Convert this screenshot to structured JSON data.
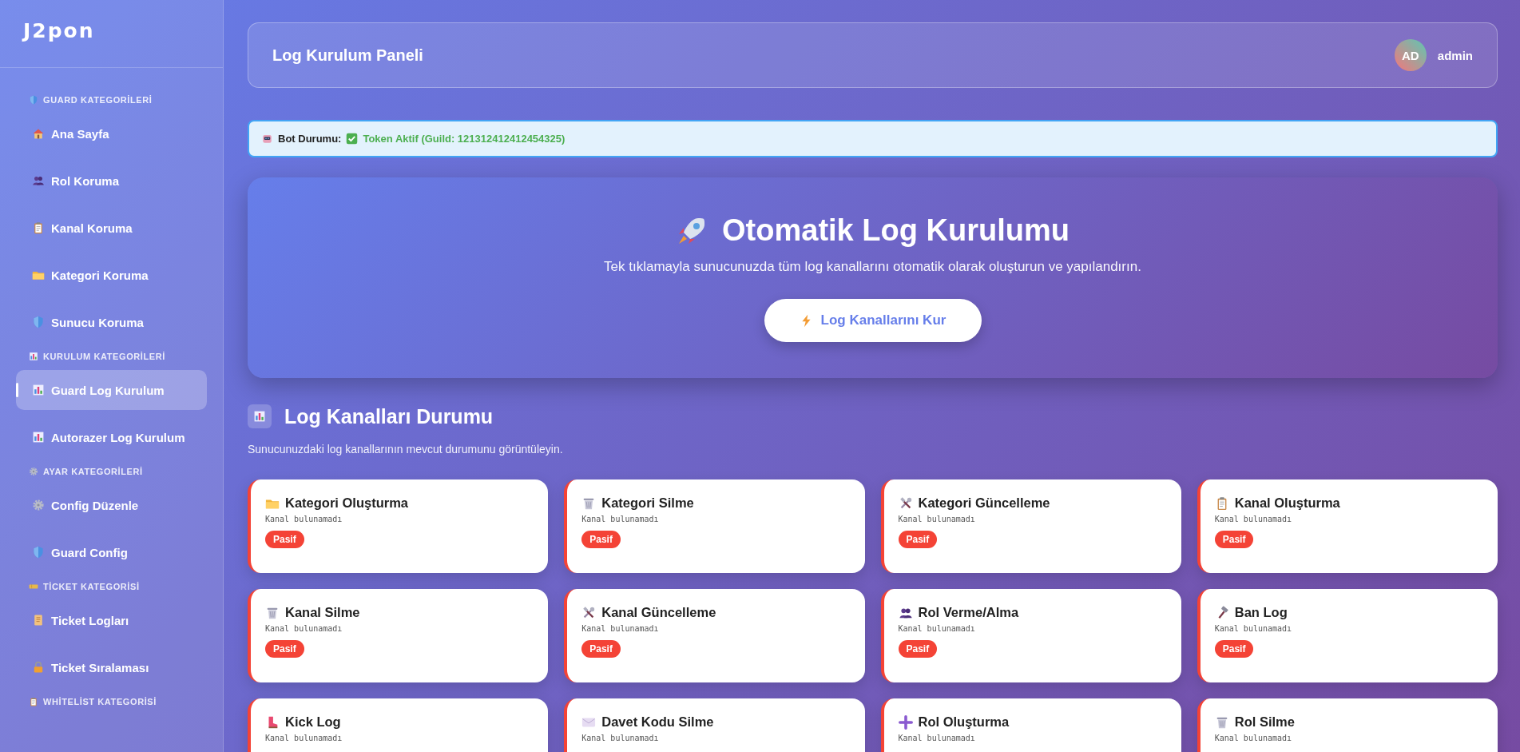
{
  "sidebar": {
    "logo": "J2pon",
    "sections": [
      {
        "title": "GUARD KATEGORİLERİ",
        "kind": "shield",
        "items": [
          {
            "label": "Ana Sayfa",
            "kind": "house",
            "selected": false
          },
          {
            "label": "Rol Koruma",
            "kind": "people",
            "selected": false
          },
          {
            "label": "Kanal Koruma",
            "kind": "clipboard",
            "selected": false
          },
          {
            "label": "Kategori Koruma",
            "kind": "folder",
            "selected": false
          },
          {
            "label": "Sunucu Koruma",
            "kind": "shield",
            "selected": false
          }
        ]
      },
      {
        "title": "KURULUM KATEGORİLERİ",
        "kind": "chart",
        "items": [
          {
            "label": "Guard Log Kurulum",
            "kind": "chart",
            "selected": true
          },
          {
            "label": "Autorazer Log Kurulum",
            "kind": "chart",
            "selected": false
          }
        ]
      },
      {
        "title": "AYAR KATEGORİLERİ",
        "kind": "gear",
        "items": [
          {
            "label": "Config Düzenle",
            "kind": "gear",
            "selected": false
          },
          {
            "label": "Guard Config",
            "kind": "shield",
            "selected": false
          }
        ]
      },
      {
        "title": "TİCKET KATEGORİSİ",
        "kind": "ticket",
        "items": [
          {
            "label": "Ticket Logları",
            "kind": "scroll",
            "selected": false
          },
          {
            "label": "Ticket Sıralaması",
            "kind": "lock",
            "selected": false
          }
        ]
      },
      {
        "title": "WHİTELİST KATEGORİSİ",
        "kind": "clipboard"
      }
    ]
  },
  "header": {
    "title": "Log Kurulum Paneli",
    "user": {
      "initials": "AD",
      "name": "admin"
    }
  },
  "bot_status": {
    "label": "Bot Durumu:",
    "value": "Token Aktif (Guild: 121312412412454325)"
  },
  "hero": {
    "title": "Otomatik Log Kurulumu",
    "subtitle": "Tek tıklamayla sunucunuzda tüm log kanallarını otomatik olarak oluşturun ve yapılandırın.",
    "button": "Log Kanallarını Kur"
  },
  "channels_section": {
    "title": "Log Kanalları Durumu",
    "subtitle": "Sunucunuzdaki log kanallarının mevcut durumunu görüntüleyin.",
    "cards": [
      {
        "title": "Kategori Oluşturma",
        "kind": "folder",
        "channel": "Kanal bulunamadı",
        "status": "Pasif",
        "active": false
      },
      {
        "title": "Kategori Silme",
        "kind": "trash",
        "channel": "Kanal bulunamadı",
        "status": "Pasif",
        "active": false
      },
      {
        "title": "Kategori Güncelleme",
        "kind": "tools",
        "channel": "Kanal bulunamadı",
        "status": "Pasif",
        "active": false
      },
      {
        "title": "Kanal Oluşturma",
        "kind": "clipboard",
        "channel": "Kanal bulunamadı",
        "status": "Pasif",
        "active": false
      },
      {
        "title": "Kanal Silme",
        "kind": "trash",
        "channel": "Kanal bulunamadı",
        "status": "Pasif",
        "active": false
      },
      {
        "title": "Kanal Güncelleme",
        "kind": "tools",
        "channel": "Kanal bulunamadı",
        "status": "Pasif",
        "active": false
      },
      {
        "title": "Rol Verme/Alma",
        "kind": "people",
        "channel": "Kanal bulunamadı",
        "status": "Pasif",
        "active": false
      },
      {
        "title": "Ban Log",
        "kind": "hammer",
        "channel": "Kanal bulunamadı",
        "status": "Pasif",
        "active": false
      },
      {
        "title": "Kick Log",
        "kind": "boot",
        "channel": "Kanal bulunamadı",
        "active": false
      },
      {
        "title": "Davet Kodu Silme",
        "kind": "envelope",
        "channel": "Kanal bulunamadı",
        "active": false
      },
      {
        "title": "Rol Oluşturma",
        "kind": "plus",
        "channel": "Kanal bulunamadı",
        "active": false
      },
      {
        "title": "Rol Silme",
        "kind": "trash",
        "channel": "Kanal bulunamadı",
        "active": false
      }
    ]
  }
}
